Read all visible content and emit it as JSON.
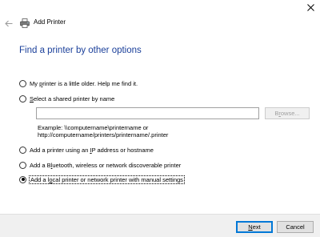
{
  "window": {
    "title": "Add Printer"
  },
  "main": {
    "heading": "Find a printer by other options",
    "options": [
      {
        "pre": "My ",
        "accel": "p",
        "post": "rinter is a little older. Help me find it.",
        "checked": false
      },
      {
        "pre": "",
        "accel": "S",
        "post": "elect a shared printer by name",
        "checked": false
      },
      {
        "pre": "Add a printer using an ",
        "accel": "I",
        "post": "P address or hostname",
        "checked": false
      },
      {
        "pre": "Add a B",
        "accel": "l",
        "post": "uetooth, wireless or network discoverable printer",
        "checked": false
      },
      {
        "pre": "Add a l",
        "accel": "o",
        "post": "cal printer or network printer with manual settings",
        "checked": true
      }
    ],
    "shared_printer_input": {
      "value": "",
      "placeholder": ""
    },
    "browse": {
      "pre": "B",
      "accel": "r",
      "post": "owse..."
    },
    "example_line1": "Example: \\\\computername\\printername or",
    "example_line2": "http://computername/printers/printername/.printer"
  },
  "footer": {
    "next": {
      "pre": "",
      "accel": "N",
      "post": "ext"
    },
    "cancel_label": "Cancel"
  },
  "colors": {
    "heading": "#1a3f9a",
    "default_button_border": "#0078d7",
    "footer_bg": "#f0f0f0"
  }
}
